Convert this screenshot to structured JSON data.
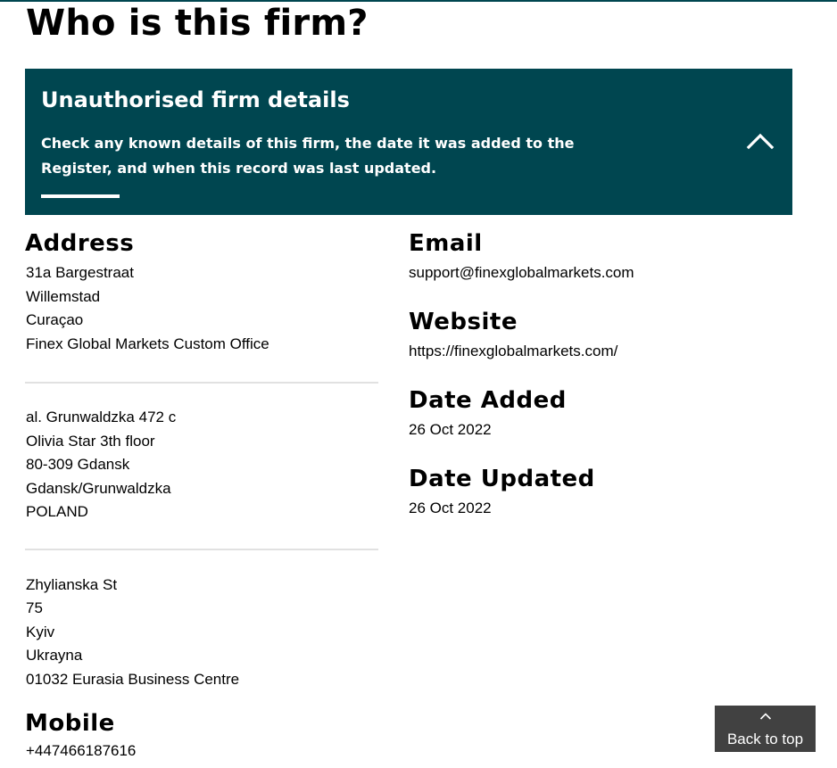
{
  "page": {
    "title": "Who is this firm?"
  },
  "panel": {
    "heading": "Unauthorised firm details",
    "description": "Check any known details of this firm, the date it was added to the Register, and when this record was last updated.",
    "toggle_icon": "chevron-up-icon",
    "background_color": "#004650"
  },
  "address": {
    "heading": "Address",
    "blocks": [
      {
        "lines": [
          "31a Bargestraat",
          "Willemstad",
          "Curaçao",
          "Finex Global Markets Custom Office"
        ]
      },
      {
        "lines": [
          "al. Grunwaldzka 472 c",
          "Olivia Star 3th floor",
          "80-309 Gdansk",
          "Gdansk/Grunwaldzka",
          "POLAND"
        ]
      },
      {
        "lines": [
          "Zhylianska St",
          "75",
          "Kyiv",
          "Ukrayna",
          "01032 Eurasia Business Centre"
        ]
      }
    ]
  },
  "mobile": {
    "heading": "Mobile",
    "value": "+447466187616"
  },
  "email": {
    "heading": "Email",
    "value": "support@finexglobalmarkets.com"
  },
  "website": {
    "heading": "Website",
    "value": "https://finexglobalmarkets.com/"
  },
  "date_added": {
    "heading": "Date Added",
    "value": "26 Oct 2022"
  },
  "date_updated": {
    "heading": "Date Updated",
    "value": "26 Oct 2022"
  },
  "back_to_top": {
    "label": "Back to top",
    "icon": "chevron-up-icon",
    "background_color": "#414141"
  }
}
